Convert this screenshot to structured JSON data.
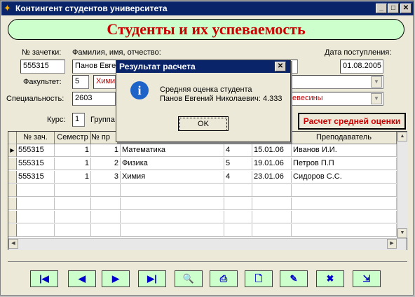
{
  "window": {
    "title": "Контингент студентов университета",
    "minimize": "_",
    "maximize": "□",
    "close": "✕"
  },
  "header": {
    "title": "Студенты и их успеваемость"
  },
  "form": {
    "record_label": "№ зачетки:",
    "record_value": "555315",
    "name_label": "Фамилия, имя, отчество:",
    "name_value": "Панов Евге",
    "date_label": "Дата поступления:",
    "date_value": "01.08.2005",
    "faculty_label": "Факультет:",
    "faculty_code": "5",
    "faculty_value": "Хими",
    "specialty_label": "Специальность:",
    "specialty_code": "2603",
    "specialty_value": "евесины",
    "course_label": "Курс:",
    "course_value": "1",
    "group_label": "Группа"
  },
  "calc_button": {
    "label": "Расчет средней оценки"
  },
  "grid": {
    "headers": [
      "№ зач.",
      "Семестр",
      "№ пр",
      "",
      "",
      "",
      "Преподаватель"
    ],
    "rows": [
      {
        "zach": "555315",
        "sem": "1",
        "num": "1",
        "subject": "Математика",
        "grade": "4",
        "date": "15.01.06",
        "teacher": "Иванов И.И."
      },
      {
        "zach": "555315",
        "sem": "1",
        "num": "2",
        "subject": "Физика",
        "grade": "5",
        "date": "19.01.06",
        "teacher": "Петров П.П"
      },
      {
        "zach": "555315",
        "sem": "1",
        "num": "3",
        "subject": "Химия",
        "grade": "4",
        "date": "23.01.06",
        "teacher": "Сидоров С.С."
      }
    ],
    "current_row_marker": "▶"
  },
  "dialog": {
    "title": "Результат расчета",
    "close": "✕",
    "icon": "i",
    "line1": "Средняя оценка студента",
    "line2": "Панов Евгений Николаевич: 4.333",
    "ok_label": "OK"
  },
  "navigation": {
    "icons": [
      "first-record-icon",
      "previous-record-icon",
      "next-record-icon",
      "last-record-icon",
      "search-icon",
      "print-icon",
      "new-record-icon",
      "edit-icon",
      "delete-icon",
      "exit-icon"
    ],
    "glyphs": [
      "|◀",
      "◀",
      "▶",
      "▶|",
      "🔍",
      "⎙",
      "🗋",
      "✎",
      "✖",
      "⇲"
    ]
  },
  "colors": {
    "title_red": "#cc0000",
    "header_green": "#ccffcc",
    "titlebar_blue": "#0a246a"
  }
}
